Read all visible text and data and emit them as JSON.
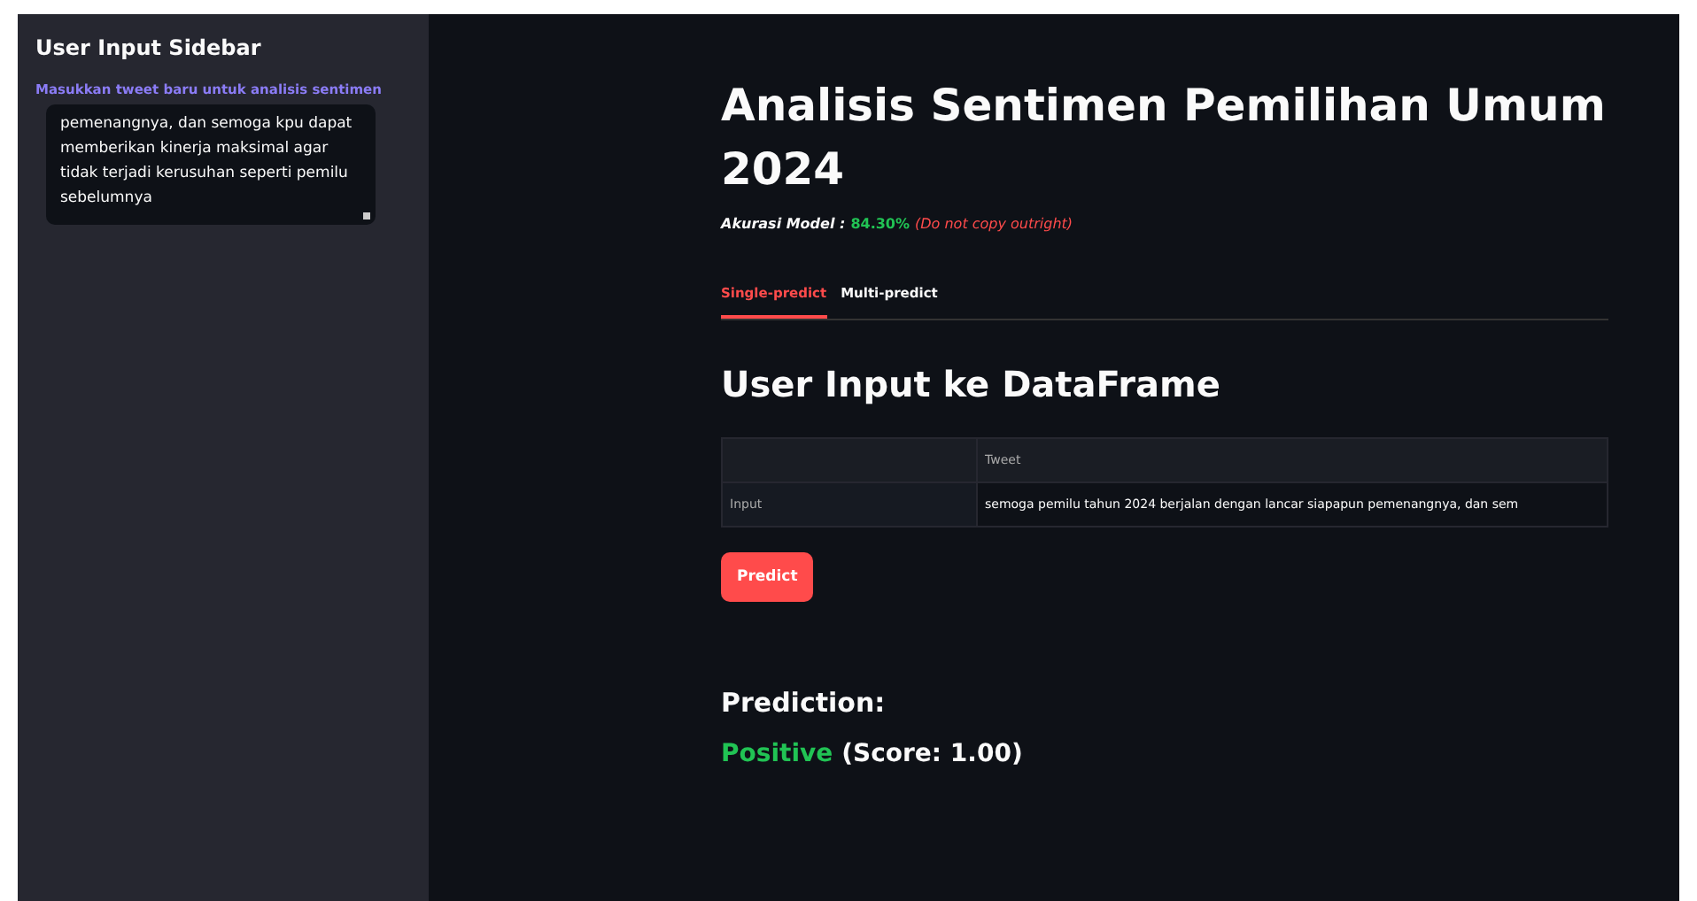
{
  "sidebar": {
    "title": "User Input Sidebar",
    "field_label": "Masukkan tweet baru untuk analisis sentimen",
    "textarea_value": "pemenangnya, dan semoga kpu dapat memberikan kinerja maksimal agar tidak terjadi kerusuhan seperti pemilu sebelumnya"
  },
  "main": {
    "title": "Analisis Sentimen Pemilihan Umum 2024",
    "accuracy_label": "Akurasi Model :",
    "accuracy_value": "84.30%",
    "note": "(Do not copy outright)",
    "tabs": [
      {
        "label": "Single-predict",
        "selected": true
      },
      {
        "label": "Multi-predict",
        "selected": false
      }
    ],
    "section_title": "User Input ke DataFrame",
    "table": {
      "columns": [
        "",
        "Tweet"
      ],
      "rows": [
        [
          "Input",
          "semoga pemilu tahun 2024 berjalan dengan lancar siapapun pemenangnya, dan sem"
        ]
      ]
    },
    "predict_button": "Predict",
    "prediction_heading": "Prediction:",
    "result_label": "Positive",
    "result_score": "(Score: 1.00)"
  }
}
